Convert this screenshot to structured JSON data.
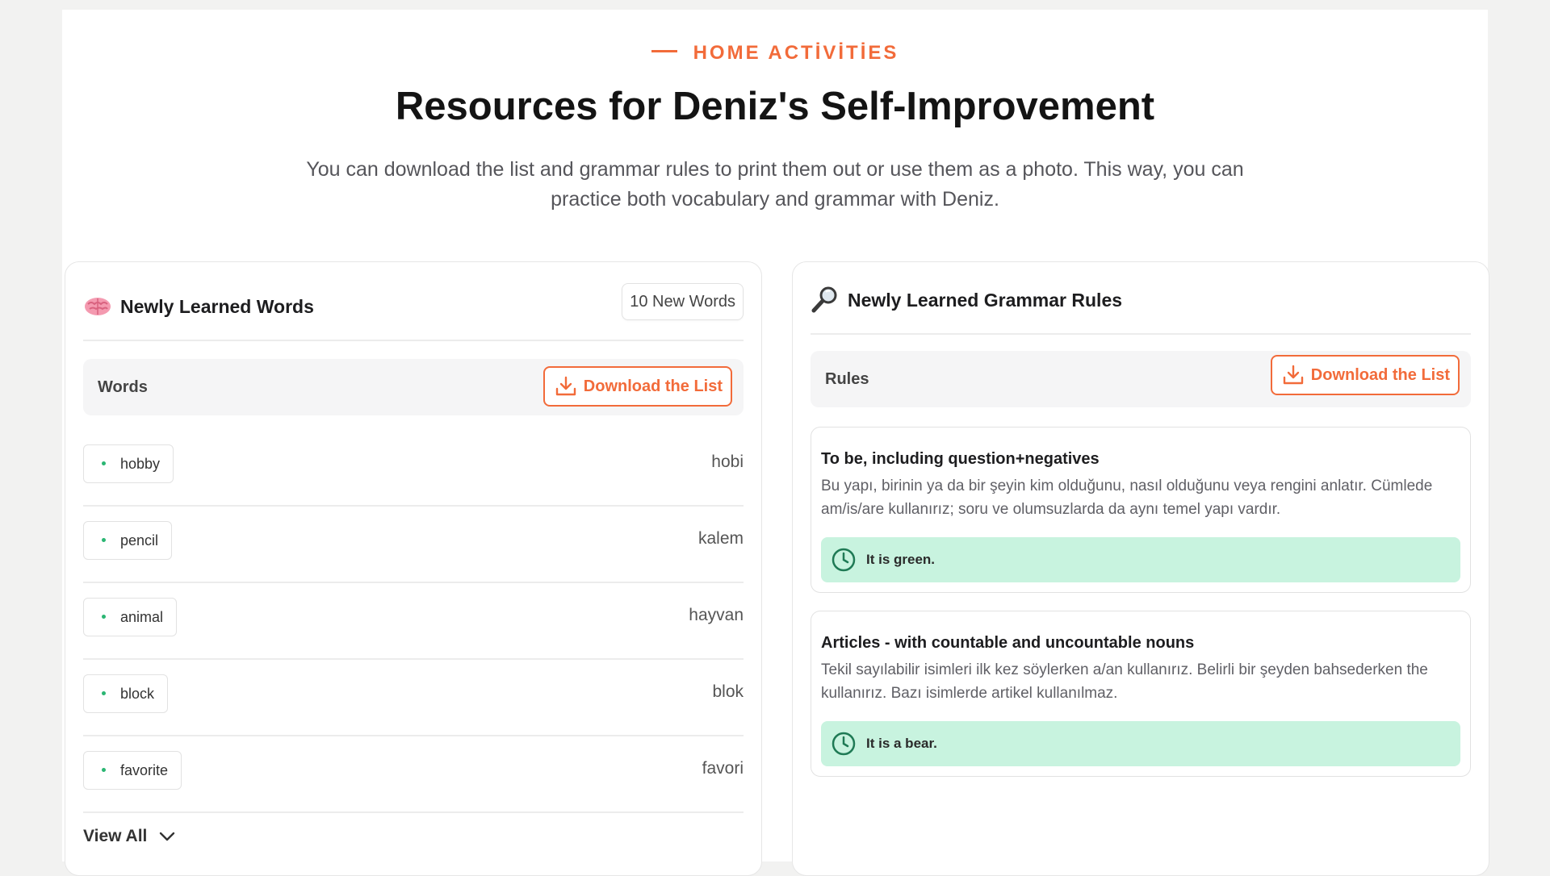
{
  "header": {
    "eyebrow": "HOME ACTİVİTİES",
    "title": "Resources for Deniz's Self-Improvement",
    "subtitle": "You can download the list and grammar rules to print them out or use them as a photo. This way, you can practice both vocabulary and grammar with Deniz."
  },
  "words_card": {
    "icon": "brain-icon",
    "title": "Newly Learned Words",
    "badge": "10 New Words",
    "bar_label": "Words",
    "download_label": "Download the List",
    "items": [
      {
        "word": "hobby",
        "translation": "hobi"
      },
      {
        "word": "pencil",
        "translation": "kalem"
      },
      {
        "word": "animal",
        "translation": "hayvan"
      },
      {
        "word": "block",
        "translation": "blok"
      },
      {
        "word": "favorite",
        "translation": "favori"
      }
    ],
    "view_all": "View All"
  },
  "grammar_card": {
    "icon": "magnifier-icon",
    "title": "Newly Learned Grammar Rules",
    "bar_label": "Rules",
    "download_label": "Download the List",
    "rules": [
      {
        "title": "To be, including question+negatives",
        "description": "Bu yapı, birinin ya da bir şeyin kim olduğunu, nasıl olduğunu veya rengini anlatır. Cümlede am/is/are kullanırız; soru ve olumsuzlarda da aynı temel yapı vardır.",
        "example": "It is green."
      },
      {
        "title": "Articles - with countable and uncountable nouns",
        "description": "Tekil sayılabilir isimleri ilk kez söylerken a/an kullanırız. Belirli bir şeyden bahsederken the kullanırız. Bazı isimlerde artikel kullanılmaz.",
        "example": "It is a bear."
      }
    ]
  },
  "colors": {
    "accent": "#f26b3a",
    "example_bg": "#c8f3df",
    "dot": "#2bb673",
    "example_icon": "#1f7a55"
  }
}
